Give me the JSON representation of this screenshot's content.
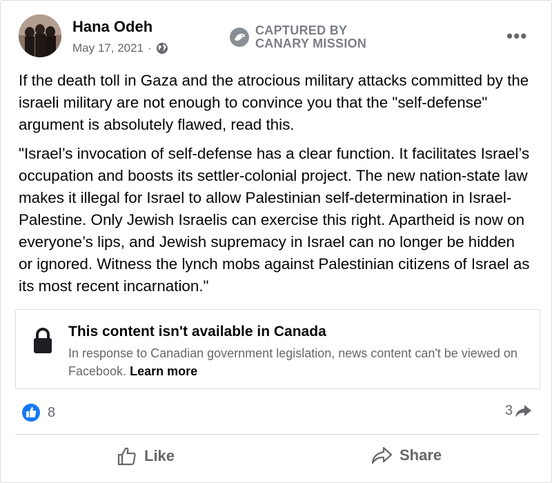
{
  "post": {
    "author": "Hana Odeh",
    "date": "May 17, 2021",
    "separator": "·",
    "privacy_icon": "globe-icon",
    "watermark": {
      "line1": "CAPTURED BY",
      "line2": "CANARY MISSION"
    },
    "paragraphs": [
      "If the death toll in Gaza and the atrocious military attacks committed by the israeli military are not enough to convince you that the \"self-defense\" argument is absolutely flawed, read this.",
      "\"Israel’s invocation of self-defense has a clear function. It facilitates Israel’s occupation and boosts its settler-colonial project. The new nation-state law makes it illegal for Israel to allow Palestinian self-determination in Israel-Palestine. Only Jewish Israelis can exercise this right. Apartheid is now on everyone’s lips, and Jewish supremacy in Israel can no longer be hidden or ignored. Witness the lynch mobs against Palestinian citizens of Israel as its most recent incarnation.\""
    ]
  },
  "notice": {
    "title": "This content isn't available in Canada",
    "description": "In response to Canadian government legislation, news content can't be viewed on Facebook.",
    "link": "Learn more"
  },
  "stats": {
    "reactions_count": "8",
    "shares_count": "3"
  },
  "actions": {
    "like": "Like",
    "share": "Share"
  },
  "colors": {
    "like_blue": "#1877f2",
    "secondary_text": "#65676b",
    "divider": "#ced0d4"
  }
}
